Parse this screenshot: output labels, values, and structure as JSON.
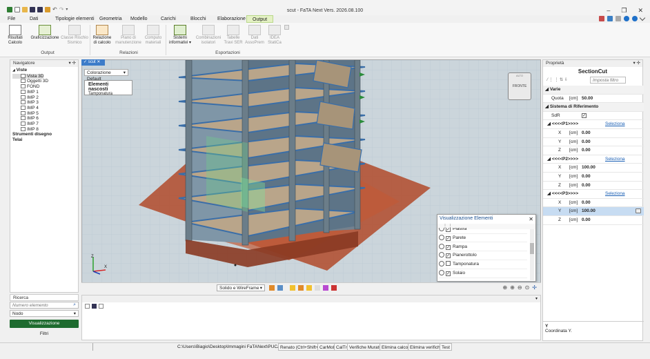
{
  "window": {
    "title": "scut - FaTA Next Vers. 2026.08.100",
    "controls": [
      "–",
      "❐",
      "✕"
    ]
  },
  "menu": [
    {
      "label": "File"
    },
    {
      "label": "Dati"
    },
    {
      "label": "Tipologie elementi"
    },
    {
      "label": "Geometria"
    },
    {
      "label": "Modello"
    },
    {
      "label": "Carichi"
    },
    {
      "label": "Blocchi"
    },
    {
      "label": "Elaborazione"
    },
    {
      "label": "Output",
      "active": true
    }
  ],
  "ribbon": {
    "groups": [
      {
        "label": "Output"
      },
      {
        "label": "Relazioni"
      },
      {
        "label": "Esportazioni"
      }
    ],
    "buttons": [
      {
        "label1": "Risultati",
        "label2": "Calcolo",
        "enabled": true
      },
      {
        "label1": "Graficizzazione",
        "label2": "",
        "enabled": true
      },
      {
        "label1": "Classe Rischio",
        "label2": "Sismico",
        "enabled": false
      },
      {
        "label1": "Relazione",
        "label2": "di calcolo",
        "enabled": true
      },
      {
        "label1": "Piano di",
        "label2": "manutenzione",
        "enabled": false
      },
      {
        "label1": "Computo",
        "label2": "materiali",
        "enabled": false
      },
      {
        "label1": "Sistemi",
        "label2": "informativi ▾",
        "enabled": true
      },
      {
        "label1": "Combinazioni",
        "label2": "isolatori",
        "enabled": false
      },
      {
        "label1": "Tabelle",
        "label2": "Travi SER",
        "enabled": false
      },
      {
        "label1": "Dati",
        "label2": "AssoPrem",
        "enabled": false
      },
      {
        "label1": "IDEA",
        "label2": "StatiCa",
        "enabled": false
      }
    ]
  },
  "navigator": {
    "title": "Navigatore",
    "pin": "▾ ✢",
    "root": "Viste",
    "items": [
      "Vista 3D",
      "Oggetti 3D",
      "FOND",
      "IMP 1",
      "IMP 2",
      "IMP 3",
      "IMP 4",
      "IMP 5",
      "IMP 6",
      "IMP 7",
      "IMP 8"
    ],
    "others": [
      "Strumenti disegno",
      "Telai"
    ]
  },
  "search": {
    "title": "Ricerca",
    "placeholder": "Numero elemento",
    "select": "Nodo",
    "button": "Visualizzazione",
    "filter": "Filtri"
  },
  "viewport": {
    "tab": "scut",
    "coloring": "Colorazione Default",
    "hidden_title": "Elementi nascosti",
    "hidden_item": "Tamponatura",
    "cube_face": "FRONTE",
    "cube_top": "ALTO",
    "render_mode": "Solido e WireFrame",
    "axis_x": "X",
    "axis_z": "Z"
  },
  "vis_panel": {
    "title": "Visualizzazione Elementi",
    "items": [
      {
        "label": "Piastra",
        "checked": true
      },
      {
        "label": "Parete",
        "checked": true
      },
      {
        "label": "Rampa",
        "checked": true
      },
      {
        "label": "Pianerottolo",
        "checked": true
      },
      {
        "label": "Tamponatura",
        "checked": false
      },
      {
        "label": "Solaio",
        "checked": true
      }
    ]
  },
  "properties": {
    "title": "Proprietà",
    "object": "SectionCut",
    "filter_placeholder": "Imposta filtro",
    "varie": "Varie",
    "quota": {
      "label": "Quota",
      "unit": "[cm]",
      "value": "50.00"
    },
    "srif": "Sistema di Riferimento",
    "sdr": "SdR",
    "select": "Seleziona",
    "points": [
      {
        "name": "<<<<P1>>>>",
        "x": "0.00",
        "y": "0.00",
        "z": "0.00"
      },
      {
        "name": "<<<<P2>>>>",
        "x": "100.00",
        "y": "0.00",
        "z": "0.00"
      },
      {
        "name": "<<<<P3>>>>",
        "x": "0.00",
        "y": "100.00",
        "z": "0.00"
      }
    ],
    "axis_labels": [
      "X",
      "Y",
      "Z"
    ],
    "unit": "[cm]",
    "desc_title": "Y",
    "desc_text": "Coordinata Y."
  },
  "status": {
    "path": "C:\\Users\\Biagio\\Desktop\\Immagini FaTANext\\PUCA 2.fnx",
    "cells": [
      "Renato (Ctrl+Shift+R)",
      "CarMob",
      "CalTrc",
      "Verifiche Muratura",
      "Elimina calcolo",
      "Elimina verifiche",
      "Test"
    ]
  }
}
